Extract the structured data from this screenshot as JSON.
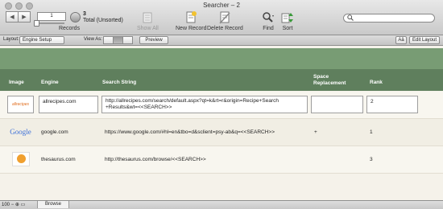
{
  "window": {
    "title": "Searcher – 2"
  },
  "toolbar": {
    "record_number": "1",
    "record_count": "3",
    "total_label": "Total (Unsorted)",
    "records_label": "Records",
    "show_all_label": "Show All",
    "new_record_label": "New Record",
    "delete_record_label": "Delete Record",
    "find_label": "Find",
    "sort_label": "Sort",
    "search_placeholder": ""
  },
  "layout_bar": {
    "layout_label": "Layout:",
    "layout_value": "Engine Setup",
    "view_as_label": "View As:",
    "preview_label": "Preview",
    "aa_label": "Aâ",
    "edit_layout_label": "Edit Layout"
  },
  "table": {
    "headers": {
      "image": "Image",
      "engine": "Engine",
      "search_string": "Search String",
      "space_replacement": "Space Replacement",
      "rank": "Rank"
    },
    "rows": [
      {
        "logo": "allrecipes",
        "engine": "allrecipes.com",
        "search_string": "http://allrecipes.com/search/default.aspx?qt=k&rt=r&origin=Recipe+Search +Results&wt=<<SEARCH>>",
        "space_replacement": "",
        "rank": "2"
      },
      {
        "logo": "Google",
        "engine": "google.com",
        "search_string": "https://www.google.com/#hl=en&tbo=d&sclient=psy-ab&q=<<SEARCH>>",
        "space_replacement": "+",
        "rank": "1"
      },
      {
        "logo": "",
        "engine": "thesaurus.com",
        "search_string": "http://thesaurus.com/browse/<<SEARCH>>",
        "space_replacement": "",
        "rank": "3"
      }
    ]
  },
  "status": {
    "zoom": "100",
    "mode": "Browse"
  },
  "colors": {
    "header_green": "#5f7f5d",
    "band_green": "#789c74",
    "google_blue": "#3b6fd8"
  },
  "icons": [
    "back-icon",
    "forward-icon",
    "pie-icon",
    "show-all-icon",
    "new-record-icon",
    "delete-record-icon",
    "find-icon",
    "sort-icon",
    "search-icon",
    "thesaurus-logo-icon"
  ]
}
